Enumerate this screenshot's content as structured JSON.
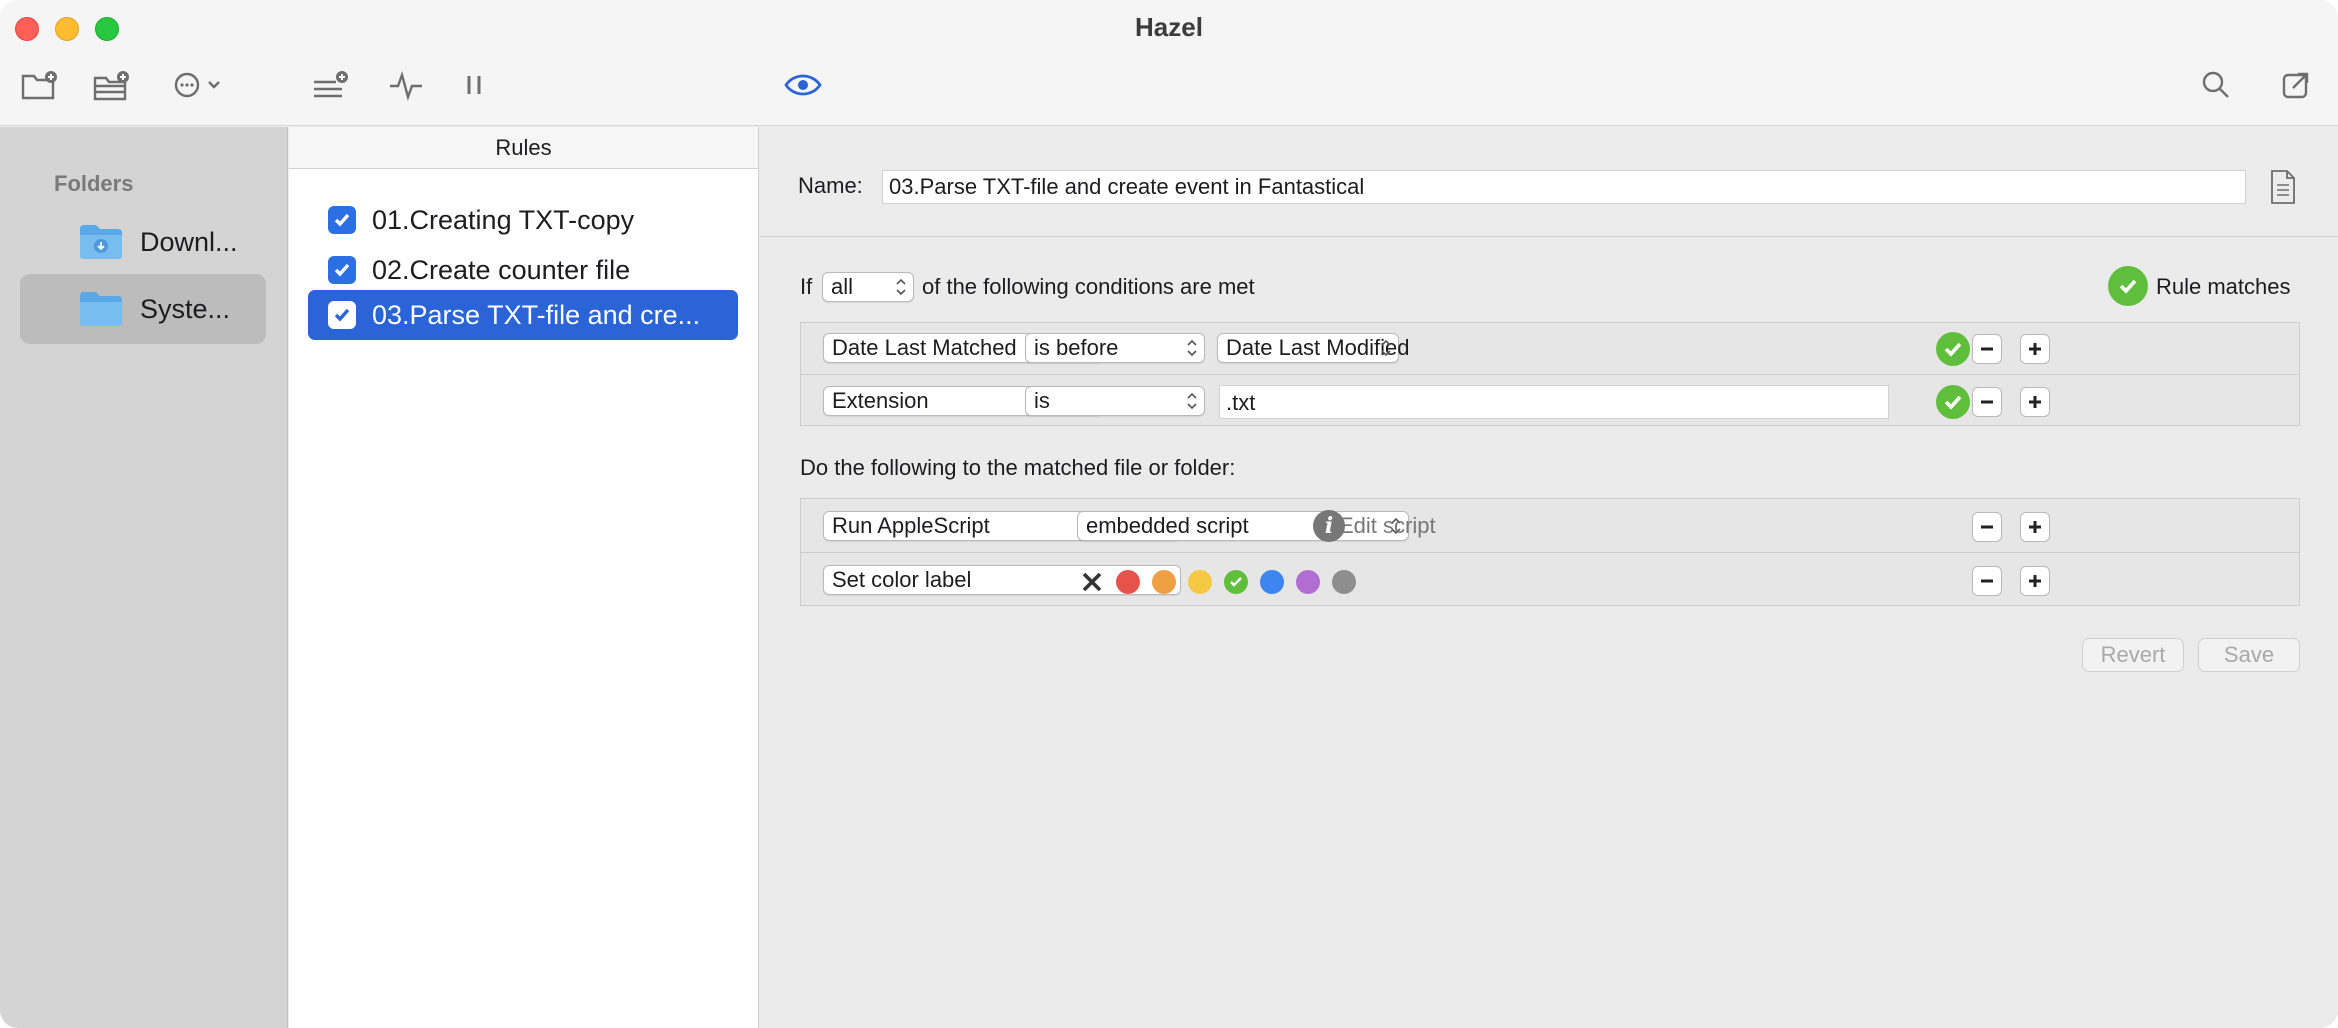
{
  "window": {
    "title": "Hazel"
  },
  "toolbar": {
    "buttons": [
      "new-folder-icon",
      "folder-settings-icon",
      "more-actions-icon",
      "new-rule-icon",
      "activity-icon",
      "pause-icon",
      "preview-eye-icon",
      "search-icon",
      "open-window-icon"
    ]
  },
  "sidebar": {
    "heading": "Folders",
    "items": [
      {
        "label": "Downl...",
        "icon": "downloads-folder-icon",
        "selected": false
      },
      {
        "label": "Syste...",
        "icon": "folder-icon",
        "selected": true
      }
    ]
  },
  "rules": {
    "header": "Rules",
    "items": [
      {
        "label": "01.Creating TXT-copy",
        "checked": true,
        "selected": false
      },
      {
        "label": "02.Create counter file",
        "checked": true,
        "selected": false
      },
      {
        "label": "03.Parse TXT-file and cre...",
        "checked": true,
        "selected": true
      }
    ]
  },
  "detail": {
    "name_label": "Name:",
    "name_value": "03.Parse TXT-file and create event in Fantastical",
    "if_label": "If",
    "match_mode": "all",
    "conditions_suffix": "of the following conditions are met",
    "rule_matches_label": "Rule matches",
    "conditions": [
      {
        "attribute": "Date Last Matched",
        "operator": "is before",
        "value": "Date Last Modified",
        "value_type": "popup"
      },
      {
        "attribute": "Extension",
        "operator": "is",
        "value": ".txt",
        "value_type": "text"
      }
    ],
    "actions_label": "Do the following to the matched file or folder:",
    "actions": [
      {
        "action": "Run AppleScript",
        "option": "embedded script",
        "edit_label": "Edit script"
      },
      {
        "action": "Set color label"
      }
    ],
    "color_labels": [
      "#e5534b",
      "#efa043",
      "#f5c944",
      "#5fbf3c",
      "#3d86f0",
      "#b26dd2",
      "#8e8e8e"
    ],
    "revert_label": "Revert",
    "save_label": "Save"
  },
  "colors": {
    "accent": "#2b64d6",
    "checkbox": "#2b6fe5",
    "match_green": "#5fbf3c",
    "eye_icon": "#2b64d6"
  }
}
